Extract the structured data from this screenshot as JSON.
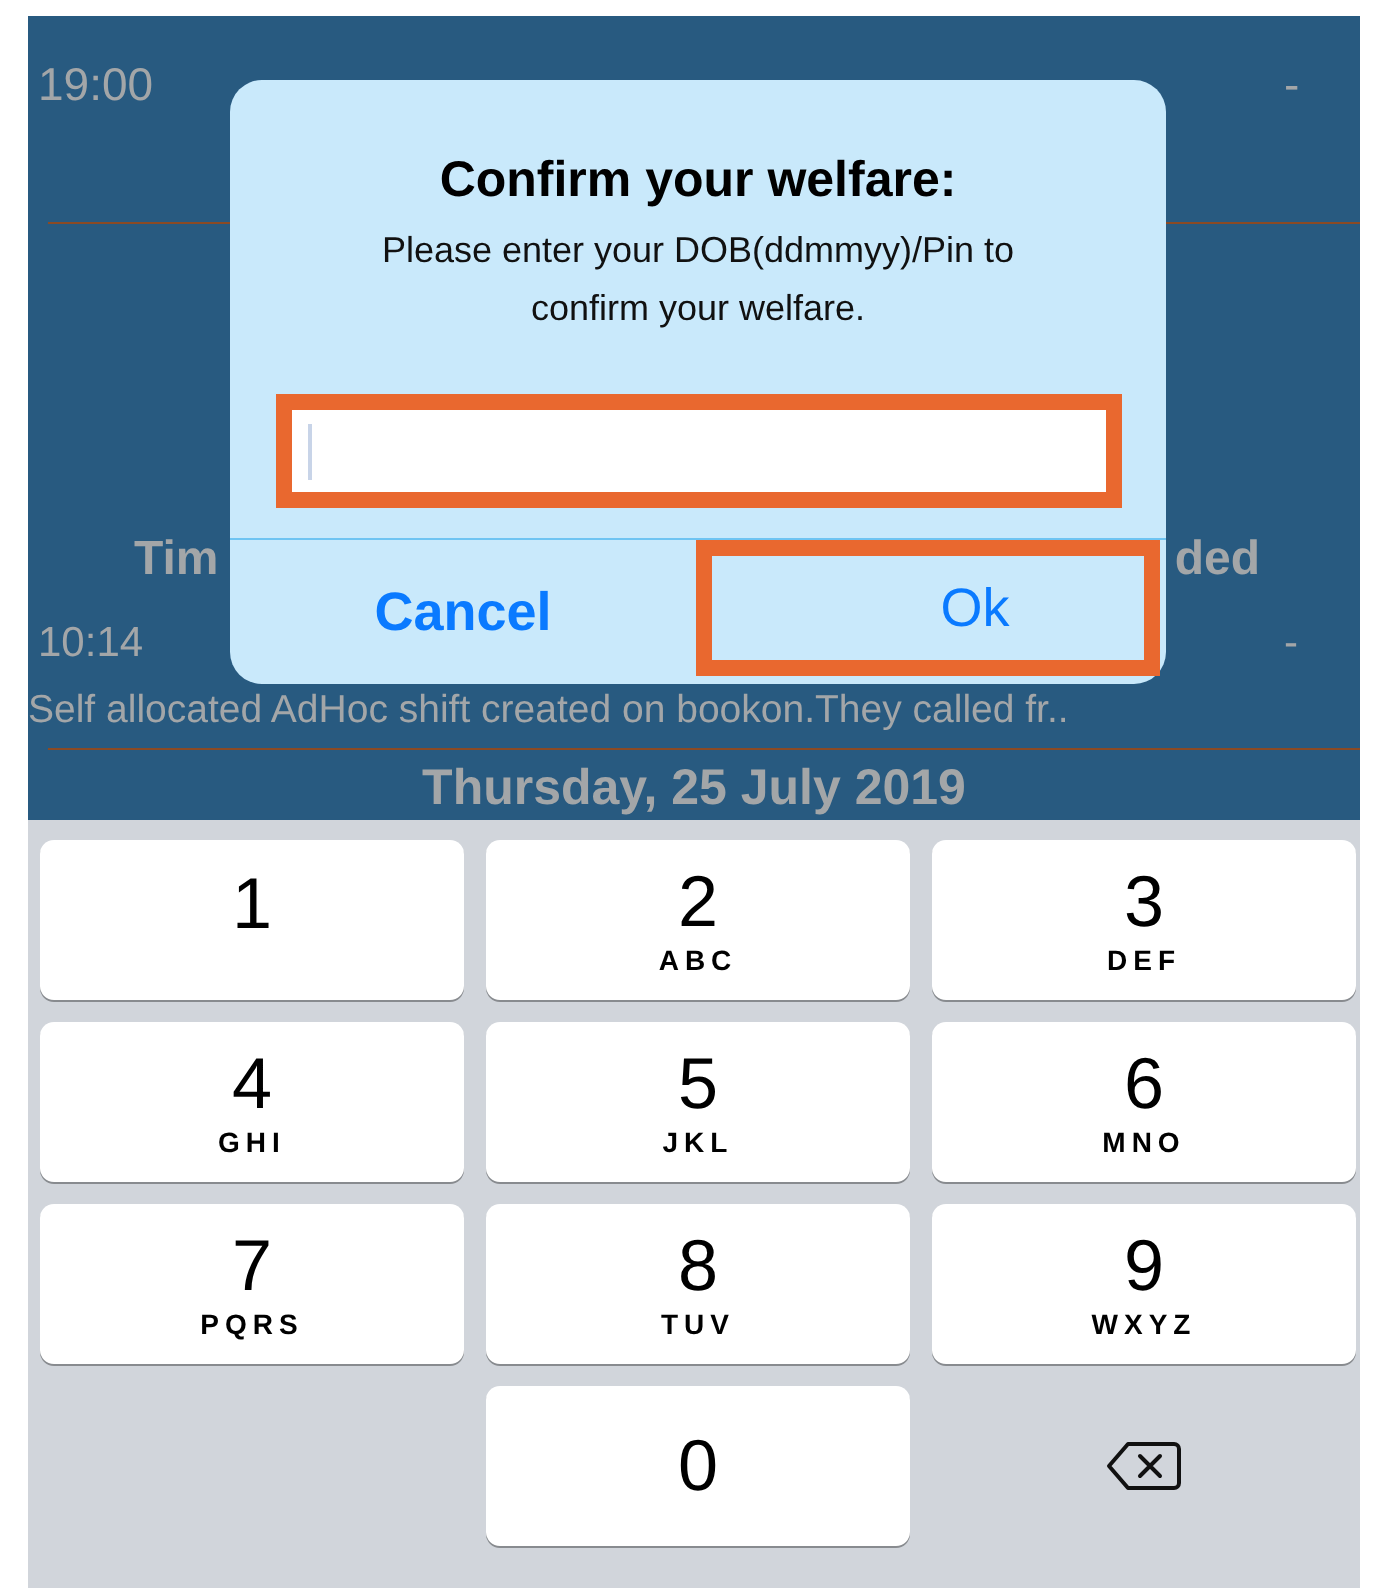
{
  "schedule": {
    "first_shift": {
      "start": "19:00",
      "status": "-"
    },
    "second_shift": {
      "heading_left": "Tim",
      "heading_right": "ded",
      "start": "10:14",
      "status": "-",
      "note": "Self allocated AdHoc shift created on bookon.They called fr.."
    },
    "date": "Thursday, 25 July 2019"
  },
  "dialog": {
    "title": "Confirm your welfare:",
    "message": "Please enter your DOB(ddmmyy)/Pin to confirm your welfare.",
    "input": {
      "highlighted": true
    },
    "buttons": [
      {
        "label": "Cancel",
        "bold": true,
        "highlighted": false
      },
      {
        "label": "Ok",
        "bold": false,
        "highlighted": true
      }
    ]
  },
  "keypad": {
    "keys": [
      {
        "kind": "digit",
        "digit": "1"
      },
      {
        "kind": "digit",
        "digit": "2",
        "letters": "ABC"
      },
      {
        "kind": "digit",
        "digit": "3",
        "letters": "DEF"
      },
      {
        "kind": "digit",
        "digit": "4",
        "letters": "GHI"
      },
      {
        "kind": "digit",
        "digit": "5",
        "letters": "JKL"
      },
      {
        "kind": "digit",
        "digit": "6",
        "letters": "MNO"
      },
      {
        "kind": "digit",
        "digit": "7",
        "letters": "PQRS"
      },
      {
        "kind": "digit",
        "digit": "8",
        "letters": "TUV"
      },
      {
        "kind": "digit",
        "digit": "9",
        "letters": "WXYZ"
      },
      {
        "kind": "blank"
      },
      {
        "kind": "digit",
        "digit": "0"
      },
      {
        "kind": "backspace"
      }
    ]
  }
}
